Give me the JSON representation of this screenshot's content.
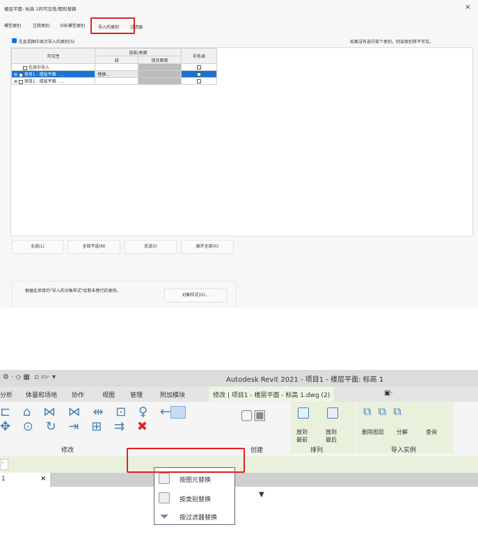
{
  "dialog": {
    "title": "楼层平面: 标高 1的可见性/图形替换",
    "close": "×",
    "tabs": [
      "模型类别",
      "注释类别",
      "分析模型类别",
      "导入的类别",
      "过滤器"
    ],
    "show_imported_label": "在此视图中显示导入的类别(S)",
    "hint": "如果没有选中某个类别，则该类别将不可见。",
    "table": {
      "col_visibility": "可见性",
      "col_projection": "投影/表面",
      "col_line": "线",
      "col_pattern": "填充图案",
      "col_halftone": "半色调",
      "rows": [
        {
          "label": "在族中导入",
          "line": ""
        },
        {
          "label": "项目1 - 楼层平面 - ...",
          "line": "替换..."
        },
        {
          "label": "项目1 - 楼层平面 - ...",
          "line": ""
        }
      ]
    },
    "buttons": [
      "全选(L)",
      "全部不选(N)",
      "反选(I)",
      "展开全部(X)"
    ],
    "note": "根据此项目的\"导入的对象样式\"绘制未替代的类别。",
    "object_styles": "对象样式(O)..."
  },
  "revit": {
    "title": "Autodesk Revit 2021 - 项目1 - 楼层平面: 标高 1",
    "tabs": [
      "分析",
      "体量和场地",
      "协作",
      "视图",
      "管理",
      "附加模块",
      "修改 | 项目1 - 楼层平面 - 标高 1.dwg (2)"
    ],
    "panels": [
      "修改",
      "创建",
      "排列",
      "导入实例"
    ],
    "buttons": [
      "放到最前",
      "放到最后",
      "删除图层",
      "分解",
      "查询"
    ],
    "view_tab": "1",
    "view_tab_close": "×",
    "menu": [
      "按图元替换",
      "按类别替换",
      "按过滤器替换"
    ]
  }
}
